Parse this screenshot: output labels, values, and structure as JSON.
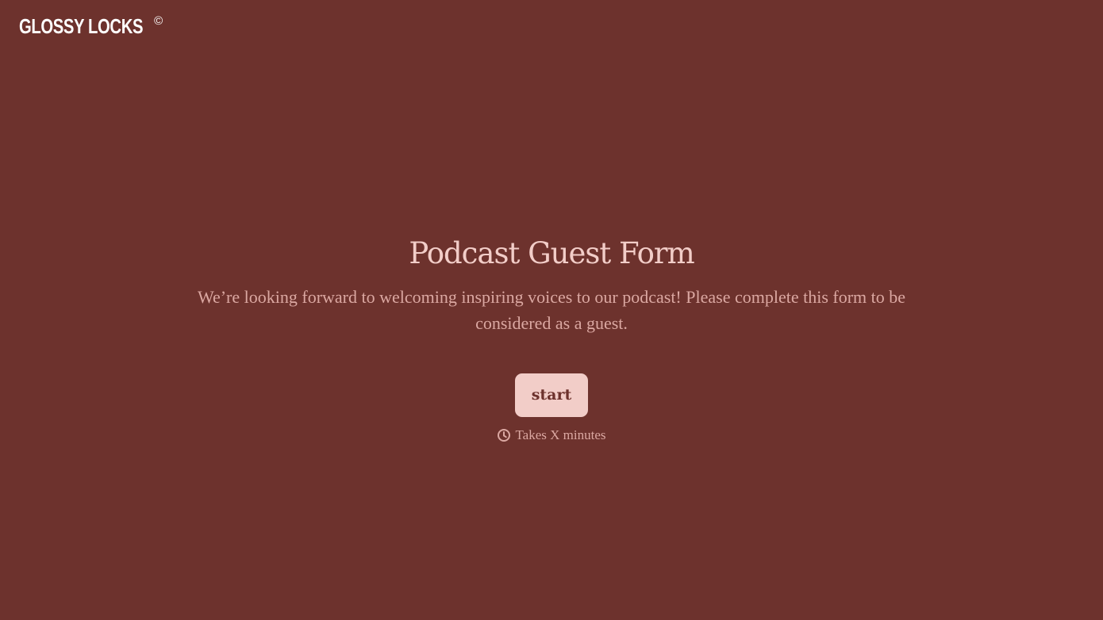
{
  "brand": {
    "name": "GLOSSY LOCKS",
    "mark": "©"
  },
  "form": {
    "title": "Podcast Guest Form",
    "description": "We’re looking forward to welcoming inspiring voices to our podcast! Please complete this form to be considered as a guest.",
    "start_label": "start",
    "duration_icon": "clock-icon",
    "duration_text": "Takes X minutes"
  },
  "colors": {
    "background": "#6d322d",
    "title": "#f2cdc8",
    "body_text": "#dba8a2",
    "button_background": "#f2cdc8",
    "button_text": "#6d322d",
    "logo": "#ffffff"
  }
}
